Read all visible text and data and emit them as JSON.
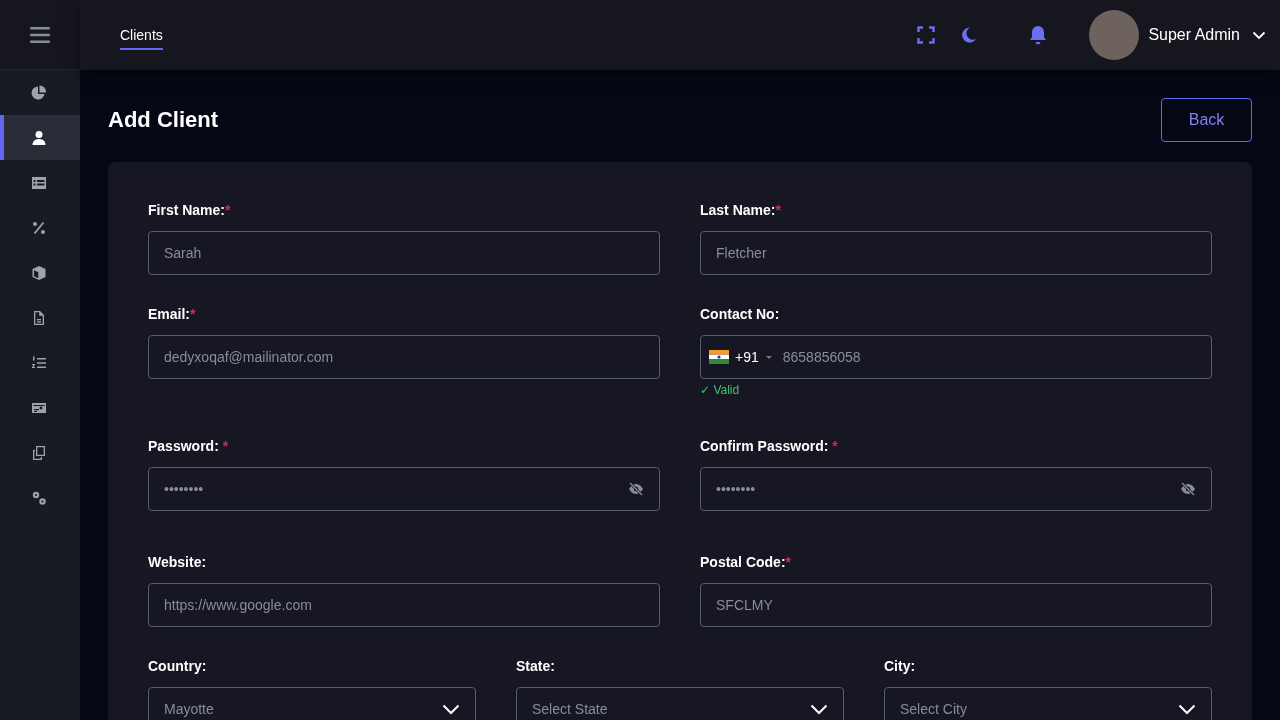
{
  "header": {
    "tab": {
      "label": "Clients",
      "selected": true
    },
    "user": {
      "name": "Super Admin"
    }
  },
  "sidebar": {
    "items": [
      {
        "selected": false
      },
      {
        "selected": true
      },
      {
        "selected": false
      },
      {
        "selected": false
      },
      {
        "selected": false
      },
      {
        "selected": false
      },
      {
        "selected": false
      },
      {
        "selected": false
      },
      {
        "selected": false
      },
      {
        "selected": false
      }
    ]
  },
  "page": {
    "title": "Add Client",
    "back_button": "Back"
  },
  "form": {
    "rows": [
      [
        {
          "kind": "text",
          "label": "First Name:",
          "required_mark": "*",
          "value": "Sarah"
        },
        {
          "kind": "text",
          "label": "Last Name:",
          "required_mark": "*",
          "value": "Fletcher"
        }
      ],
      [
        {
          "kind": "text",
          "label": "Email:",
          "required_mark": "*",
          "value": "dedyxoqaf@mailinator.com"
        },
        {
          "kind": "phone",
          "label": "Contact No:",
          "code": "+91",
          "value": "8658856058",
          "message": "✓ Valid"
        }
      ],
      [
        {
          "kind": "password",
          "label": "Password: ",
          "required_mark": "*",
          "value": "••••••••"
        },
        {
          "kind": "password",
          "label": "Confirm Password: ",
          "required_mark": "*",
          "value": "••••••••"
        }
      ],
      [
        {
          "kind": "text",
          "label": "Website:",
          "value": "https://www.google.com"
        },
        {
          "kind": "text",
          "label": "Postal Code:",
          "required_mark": "*",
          "value": "SFCLMY"
        }
      ],
      [
        {
          "kind": "select",
          "label": "Country:",
          "value": "Mayotte"
        },
        {
          "kind": "select",
          "label": "State:",
          "value": "Select State"
        },
        {
          "kind": "select",
          "label": "City:",
          "value": "Select City"
        }
      ]
    ]
  }
}
